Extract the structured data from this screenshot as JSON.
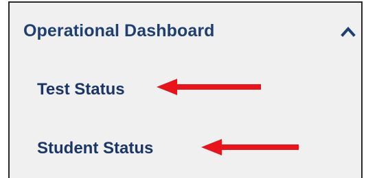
{
  "panel": {
    "section_title": "Operational Dashboard",
    "toggle_icon": "chevron-up-icon",
    "items": [
      {
        "label": "Test Status"
      },
      {
        "label": "Student Status"
      }
    ]
  },
  "annotations": {
    "arrow_color": "#e8141b",
    "arrow_icon": "red-arrow-left-icon"
  },
  "colors": {
    "panel_background": "#f0f0f0",
    "title_color": "#1f3f73",
    "item_color": "#1a3566",
    "border_color": "#2a2a2a"
  }
}
